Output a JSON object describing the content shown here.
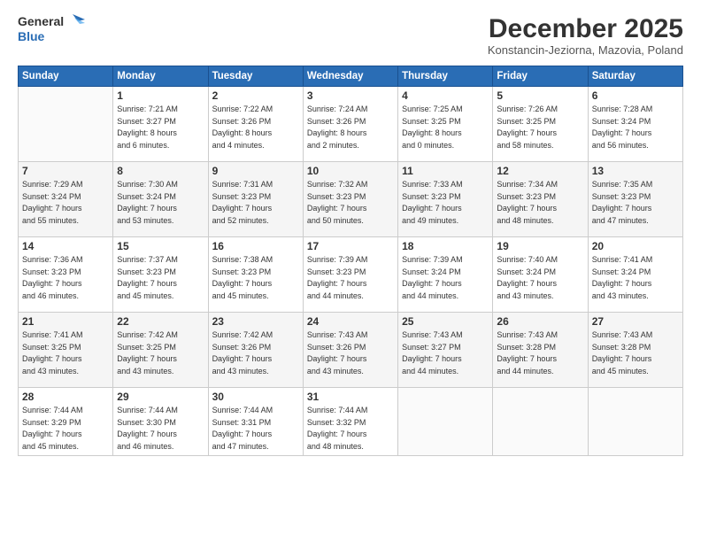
{
  "header": {
    "logo_line1": "General",
    "logo_line2": "Blue",
    "month": "December 2025",
    "location": "Konstancin-Jeziorna, Mazovia, Poland"
  },
  "weekdays": [
    "Sunday",
    "Monday",
    "Tuesday",
    "Wednesday",
    "Thursday",
    "Friday",
    "Saturday"
  ],
  "weeks": [
    [
      {
        "day": "",
        "info": ""
      },
      {
        "day": "1",
        "info": "Sunrise: 7:21 AM\nSunset: 3:27 PM\nDaylight: 8 hours\nand 6 minutes."
      },
      {
        "day": "2",
        "info": "Sunrise: 7:22 AM\nSunset: 3:26 PM\nDaylight: 8 hours\nand 4 minutes."
      },
      {
        "day": "3",
        "info": "Sunrise: 7:24 AM\nSunset: 3:26 PM\nDaylight: 8 hours\nand 2 minutes."
      },
      {
        "day": "4",
        "info": "Sunrise: 7:25 AM\nSunset: 3:25 PM\nDaylight: 8 hours\nand 0 minutes."
      },
      {
        "day": "5",
        "info": "Sunrise: 7:26 AM\nSunset: 3:25 PM\nDaylight: 7 hours\nand 58 minutes."
      },
      {
        "day": "6",
        "info": "Sunrise: 7:28 AM\nSunset: 3:24 PM\nDaylight: 7 hours\nand 56 minutes."
      }
    ],
    [
      {
        "day": "7",
        "info": "Sunrise: 7:29 AM\nSunset: 3:24 PM\nDaylight: 7 hours\nand 55 minutes."
      },
      {
        "day": "8",
        "info": "Sunrise: 7:30 AM\nSunset: 3:24 PM\nDaylight: 7 hours\nand 53 minutes."
      },
      {
        "day": "9",
        "info": "Sunrise: 7:31 AM\nSunset: 3:23 PM\nDaylight: 7 hours\nand 52 minutes."
      },
      {
        "day": "10",
        "info": "Sunrise: 7:32 AM\nSunset: 3:23 PM\nDaylight: 7 hours\nand 50 minutes."
      },
      {
        "day": "11",
        "info": "Sunrise: 7:33 AM\nSunset: 3:23 PM\nDaylight: 7 hours\nand 49 minutes."
      },
      {
        "day": "12",
        "info": "Sunrise: 7:34 AM\nSunset: 3:23 PM\nDaylight: 7 hours\nand 48 minutes."
      },
      {
        "day": "13",
        "info": "Sunrise: 7:35 AM\nSunset: 3:23 PM\nDaylight: 7 hours\nand 47 minutes."
      }
    ],
    [
      {
        "day": "14",
        "info": "Sunrise: 7:36 AM\nSunset: 3:23 PM\nDaylight: 7 hours\nand 46 minutes."
      },
      {
        "day": "15",
        "info": "Sunrise: 7:37 AM\nSunset: 3:23 PM\nDaylight: 7 hours\nand 45 minutes."
      },
      {
        "day": "16",
        "info": "Sunrise: 7:38 AM\nSunset: 3:23 PM\nDaylight: 7 hours\nand 45 minutes."
      },
      {
        "day": "17",
        "info": "Sunrise: 7:39 AM\nSunset: 3:23 PM\nDaylight: 7 hours\nand 44 minutes."
      },
      {
        "day": "18",
        "info": "Sunrise: 7:39 AM\nSunset: 3:24 PM\nDaylight: 7 hours\nand 44 minutes."
      },
      {
        "day": "19",
        "info": "Sunrise: 7:40 AM\nSunset: 3:24 PM\nDaylight: 7 hours\nand 43 minutes."
      },
      {
        "day": "20",
        "info": "Sunrise: 7:41 AM\nSunset: 3:24 PM\nDaylight: 7 hours\nand 43 minutes."
      }
    ],
    [
      {
        "day": "21",
        "info": "Sunrise: 7:41 AM\nSunset: 3:25 PM\nDaylight: 7 hours\nand 43 minutes."
      },
      {
        "day": "22",
        "info": "Sunrise: 7:42 AM\nSunset: 3:25 PM\nDaylight: 7 hours\nand 43 minutes."
      },
      {
        "day": "23",
        "info": "Sunrise: 7:42 AM\nSunset: 3:26 PM\nDaylight: 7 hours\nand 43 minutes."
      },
      {
        "day": "24",
        "info": "Sunrise: 7:43 AM\nSunset: 3:26 PM\nDaylight: 7 hours\nand 43 minutes."
      },
      {
        "day": "25",
        "info": "Sunrise: 7:43 AM\nSunset: 3:27 PM\nDaylight: 7 hours\nand 44 minutes."
      },
      {
        "day": "26",
        "info": "Sunrise: 7:43 AM\nSunset: 3:28 PM\nDaylight: 7 hours\nand 44 minutes."
      },
      {
        "day": "27",
        "info": "Sunrise: 7:43 AM\nSunset: 3:28 PM\nDaylight: 7 hours\nand 45 minutes."
      }
    ],
    [
      {
        "day": "28",
        "info": "Sunrise: 7:44 AM\nSunset: 3:29 PM\nDaylight: 7 hours\nand 45 minutes."
      },
      {
        "day": "29",
        "info": "Sunrise: 7:44 AM\nSunset: 3:30 PM\nDaylight: 7 hours\nand 46 minutes."
      },
      {
        "day": "30",
        "info": "Sunrise: 7:44 AM\nSunset: 3:31 PM\nDaylight: 7 hours\nand 47 minutes."
      },
      {
        "day": "31",
        "info": "Sunrise: 7:44 AM\nSunset: 3:32 PM\nDaylight: 7 hours\nand 48 minutes."
      },
      {
        "day": "",
        "info": ""
      },
      {
        "day": "",
        "info": ""
      },
      {
        "day": "",
        "info": ""
      }
    ]
  ]
}
